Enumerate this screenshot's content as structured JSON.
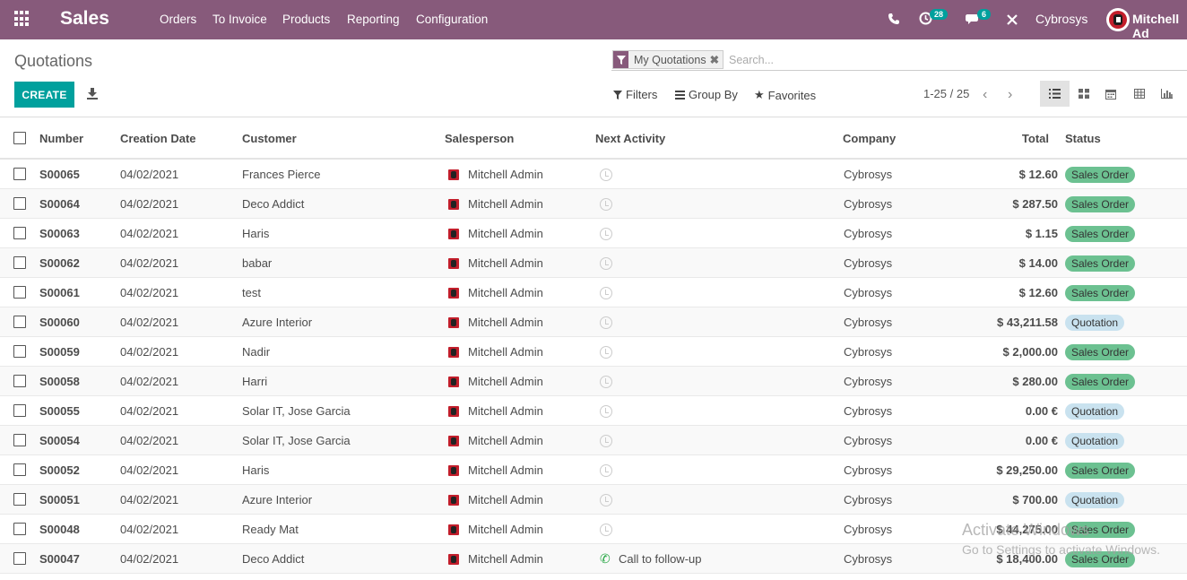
{
  "navbar": {
    "brand": "Sales",
    "menu": [
      "Orders",
      "To Invoice",
      "Products",
      "Reporting",
      "Configuration"
    ],
    "activity_count": "28",
    "messages_count": "6",
    "company": "Cybrosys",
    "user": "Mitchell Ad"
  },
  "control_panel": {
    "title": "Quotations",
    "facet": "My Quotations",
    "search_placeholder": "Search...",
    "create_label": "CREATE",
    "filters_label": "Filters",
    "groupby_label": "Group By",
    "favorites_label": "Favorites",
    "pager": "1-25 / 25"
  },
  "table": {
    "headers": {
      "number": "Number",
      "date": "Creation Date",
      "customer": "Customer",
      "salesperson": "Salesperson",
      "activity": "Next Activity",
      "company": "Company",
      "total": "Total",
      "status": "Status"
    },
    "rows": [
      {
        "number": "S00065",
        "date": "04/02/2021",
        "customer": "Frances Pierce",
        "salesperson": "Mitchell Admin",
        "activity": "",
        "company": "Cybrosys",
        "total": "$ 12.60",
        "status": "Sales Order"
      },
      {
        "number": "S00064",
        "date": "04/02/2021",
        "customer": "Deco Addict",
        "salesperson": "Mitchell Admin",
        "activity": "",
        "company": "Cybrosys",
        "total": "$ 287.50",
        "status": "Sales Order"
      },
      {
        "number": "S00063",
        "date": "04/02/2021",
        "customer": "Haris",
        "salesperson": "Mitchell Admin",
        "activity": "",
        "company": "Cybrosys",
        "total": "$ 1.15",
        "status": "Sales Order"
      },
      {
        "number": "S00062",
        "date": "04/02/2021",
        "customer": "babar",
        "salesperson": "Mitchell Admin",
        "activity": "",
        "company": "Cybrosys",
        "total": "$ 14.00",
        "status": "Sales Order"
      },
      {
        "number": "S00061",
        "date": "04/02/2021",
        "customer": "test",
        "salesperson": "Mitchell Admin",
        "activity": "",
        "company": "Cybrosys",
        "total": "$ 12.60",
        "status": "Sales Order"
      },
      {
        "number": "S00060",
        "date": "04/02/2021",
        "customer": "Azure Interior",
        "salesperson": "Mitchell Admin",
        "activity": "",
        "company": "Cybrosys",
        "total": "$ 43,211.58",
        "status": "Quotation"
      },
      {
        "number": "S00059",
        "date": "04/02/2021",
        "customer": "Nadir",
        "salesperson": "Mitchell Admin",
        "activity": "",
        "company": "Cybrosys",
        "total": "$ 2,000.00",
        "status": "Sales Order"
      },
      {
        "number": "S00058",
        "date": "04/02/2021",
        "customer": "Harri",
        "salesperson": "Mitchell Admin",
        "activity": "",
        "company": "Cybrosys",
        "total": "$ 280.00",
        "status": "Sales Order"
      },
      {
        "number": "S00055",
        "date": "04/02/2021",
        "customer": "Solar IT, Jose Garcia",
        "salesperson": "Mitchell Admin",
        "activity": "",
        "company": "Cybrosys",
        "total": "0.00 €",
        "status": "Quotation"
      },
      {
        "number": "S00054",
        "date": "04/02/2021",
        "customer": "Solar IT, Jose Garcia",
        "salesperson": "Mitchell Admin",
        "activity": "",
        "company": "Cybrosys",
        "total": "0.00 €",
        "status": "Quotation"
      },
      {
        "number": "S00052",
        "date": "04/02/2021",
        "customer": "Haris",
        "salesperson": "Mitchell Admin",
        "activity": "",
        "company": "Cybrosys",
        "total": "$ 29,250.00",
        "status": "Sales Order"
      },
      {
        "number": "S00051",
        "date": "04/02/2021",
        "customer": "Azure Interior",
        "salesperson": "Mitchell Admin",
        "activity": "",
        "company": "Cybrosys",
        "total": "$ 700.00",
        "status": "Quotation"
      },
      {
        "number": "S00048",
        "date": "04/02/2021",
        "customer": "Ready Mat",
        "salesperson": "Mitchell Admin",
        "activity": "",
        "company": "Cybrosys",
        "total": "$ 44,275.00",
        "status": "Sales Order"
      },
      {
        "number": "S00047",
        "date": "04/02/2021",
        "customer": "Deco Addict",
        "salesperson": "Mitchell Admin",
        "activity": "Call to follow-up",
        "company": "Cybrosys",
        "total": "$ 18,400.00",
        "status": "Sales Order"
      }
    ]
  },
  "watermark": {
    "line1": "Activate Windows",
    "line2": "Go to Settings to activate Windows."
  },
  "colors": {
    "navbar": "#875a7b",
    "primary": "#00a09d",
    "sales_order_badge": "#6cc191",
    "quotation_badge": "#c9e2ef"
  }
}
